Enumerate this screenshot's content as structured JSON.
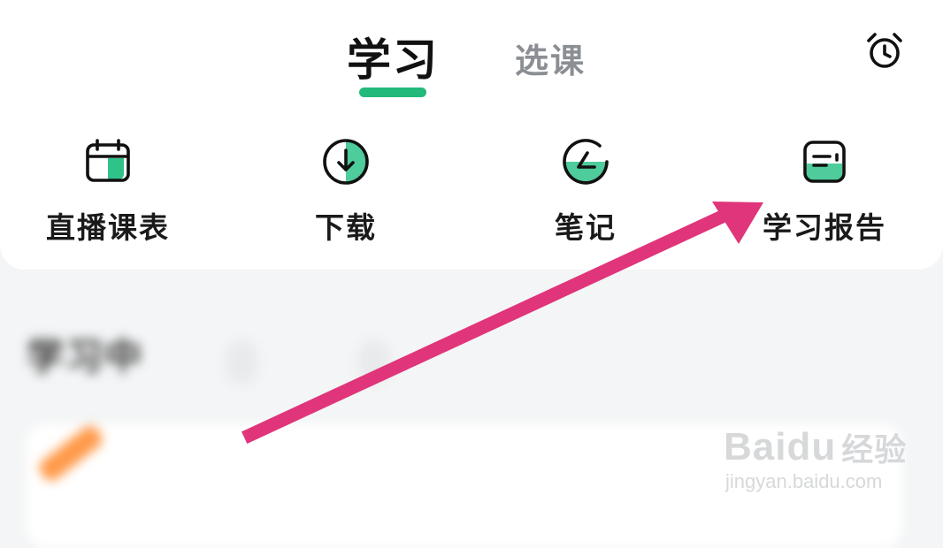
{
  "tabs": [
    {
      "label": "学习",
      "active": true
    },
    {
      "label": "选课",
      "active": false
    }
  ],
  "header_icon": "alarm-clock-icon",
  "shortcuts": [
    {
      "label": "直播课表",
      "icon": "calendar-icon"
    },
    {
      "label": "下载",
      "icon": "download-icon"
    },
    {
      "label": "笔记",
      "icon": "note-pen-icon"
    },
    {
      "label": "学习报告",
      "icon": "report-icon"
    }
  ],
  "blurred_section": {
    "title": "学习中",
    "chips": [
      "",
      ""
    ],
    "filter_label": "",
    "card_title": ""
  },
  "annotation": {
    "type": "arrow",
    "color": "#e0357a",
    "points_to": "学习报告"
  },
  "watermark": {
    "brand": "Baidu",
    "brand_cn": "经验",
    "url": "jingyan.baidu.com"
  },
  "colors": {
    "accent": "#22b97a",
    "text": "#111111",
    "inactive": "#8b8f94"
  }
}
